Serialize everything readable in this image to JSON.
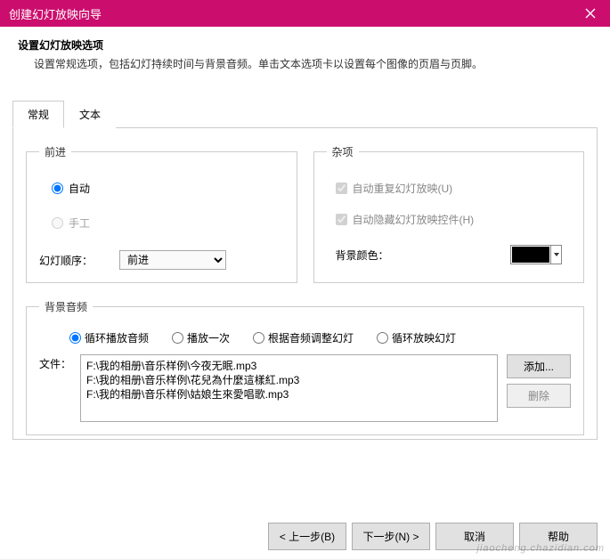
{
  "title": "创建幻灯放映向导",
  "header": {
    "title": "设置幻灯放映选项",
    "desc": "设置常规选项，包括幻灯持续时间与背景音频。单击文本选项卡以设置每个图像的页眉与页脚。"
  },
  "tabs": {
    "general": "常规",
    "text": "文本"
  },
  "advance": {
    "legend": "前进",
    "auto": "自动",
    "manual": "手工",
    "order_label": "幻灯顺序：",
    "order_value": "前进"
  },
  "misc": {
    "legend": "杂项",
    "repeat": "自动重复幻灯放映(U)",
    "hide": "自动隐藏幻灯放映控件(H)",
    "bgcolor_label": "背景颜色：",
    "bgcolor_value": "#000000"
  },
  "audio": {
    "legend": "背景音频",
    "opt_loop": "循环播放音频",
    "opt_once": "播放一次",
    "opt_adjust": "根据音频调整幻灯",
    "opt_loopslide": "循环放映幻灯",
    "files_label": "文件：",
    "files": [
      "F:\\我的相册\\音乐样例\\今夜无眠.mp3",
      "F:\\我的相册\\音乐样例\\花兒為什麼這樣紅.mp3",
      "F:\\我的相册\\音乐样例\\姑娘生來愛唱歌.mp3"
    ],
    "add": "添加...",
    "remove": "删除"
  },
  "footer": {
    "back": "< 上一步(B)",
    "next": "下一步(N) >",
    "cancel": "取消",
    "help": "帮助"
  },
  "watermark": "jiaocheng.chazidian.com"
}
